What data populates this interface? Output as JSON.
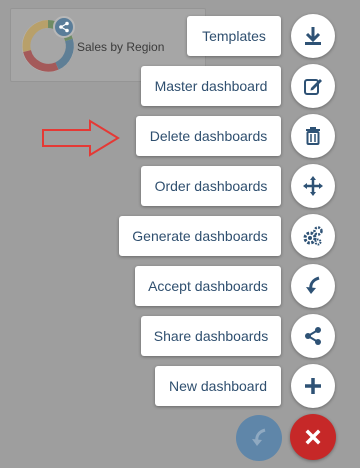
{
  "widget": {
    "title": "Sales by Region"
  },
  "menu": {
    "items": [
      {
        "label": "Templates",
        "icon": "download-icon"
      },
      {
        "label": "Master dashboard",
        "icon": "edit-icon"
      },
      {
        "label": "Delete dashboards",
        "icon": "trash-icon"
      },
      {
        "label": "Order dashboards",
        "icon": "move-icon"
      },
      {
        "label": "Generate dashboards",
        "icon": "gears-icon"
      },
      {
        "label": "Accept dashboards",
        "icon": "curved-arrow-icon"
      },
      {
        "label": "Share dashboards",
        "icon": "share-icon"
      },
      {
        "label": "New dashboard",
        "icon": "plus-icon"
      }
    ]
  },
  "fab": {
    "back_icon": "curved-arrow-icon",
    "close_icon": "close-icon"
  },
  "colors": {
    "overlay": "#9e9e9e",
    "label_text": "#2f4f6f",
    "icon": "#2e5275",
    "close": "#c62828",
    "back_fab": "#5f86a9",
    "arrow": "#e53935"
  }
}
